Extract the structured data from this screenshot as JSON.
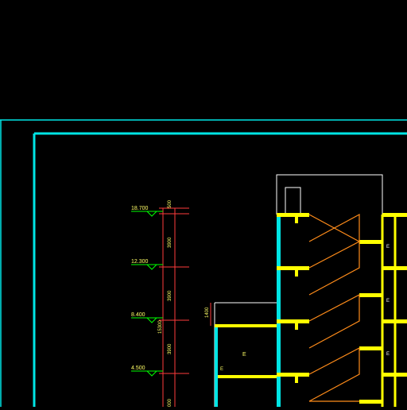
{
  "drawing": {
    "level_marks": {
      "l1": "18.700",
      "l2": "12.300",
      "l3": "8.400",
      "l4": "4.500"
    },
    "dimensions": {
      "d_top": "500",
      "d1": "3900",
      "d2": "3900",
      "d3": "3900",
      "total": "15300",
      "d_bottom": "000",
      "parapet": "1400"
    },
    "labels": {
      "room_small": "E",
      "room_mid": "E",
      "right_a": "E",
      "right_b": "E",
      "right_c": "E"
    },
    "colors": {
      "frame": "#00e5e5",
      "wall": "#ffff00",
      "stair": "#ff8c1a",
      "dim": "#ff3b3b",
      "level_marker": "#00ff00",
      "text": "#ffff66",
      "outline": "#ffffff"
    }
  }
}
